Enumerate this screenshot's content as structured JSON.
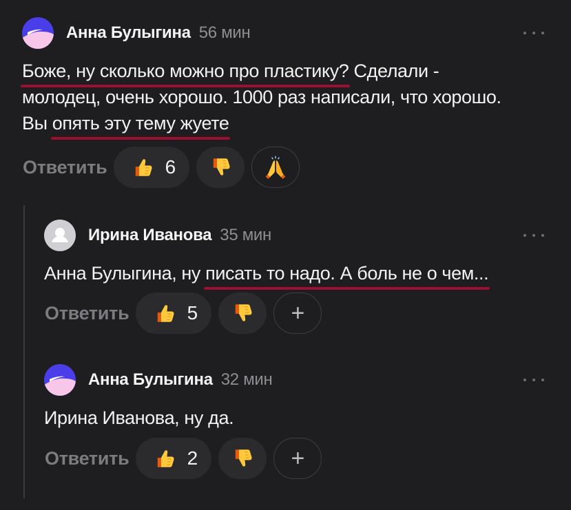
{
  "comments": [
    {
      "author": "Анна Булыгина",
      "time": "56 мин",
      "text": {
        "p1": "Боже, ну сколько можно про пластику?",
        "p2": " Сделали - молодец, очень хорошо. 1000 раз написали, что хорошо. Вы ",
        "p3": "опять эту тему жуете"
      },
      "reply_label": "Ответить",
      "likes": "6",
      "reactions": [
        "thumbs-up",
        "thumbs-down",
        "praying-hands"
      ]
    },
    {
      "author": "Ирина Иванова",
      "time": "35 мин",
      "text": {
        "p1": "Анна Булыгина, ну ",
        "p2": "писать то надо. А боль не о чем..."
      },
      "reply_label": "Ответить",
      "likes": "5",
      "add_reaction": "+"
    },
    {
      "author": "Анна Булыгина",
      "time": "32 мин",
      "text": {
        "p1": "Ирина Иванова, ну да."
      },
      "reply_label": "Ответить",
      "likes": "2",
      "add_reaction": "+"
    }
  ],
  "colors": {
    "background": "#1e1e20",
    "underline": "#9b1030",
    "muted": "#8e8e93"
  }
}
